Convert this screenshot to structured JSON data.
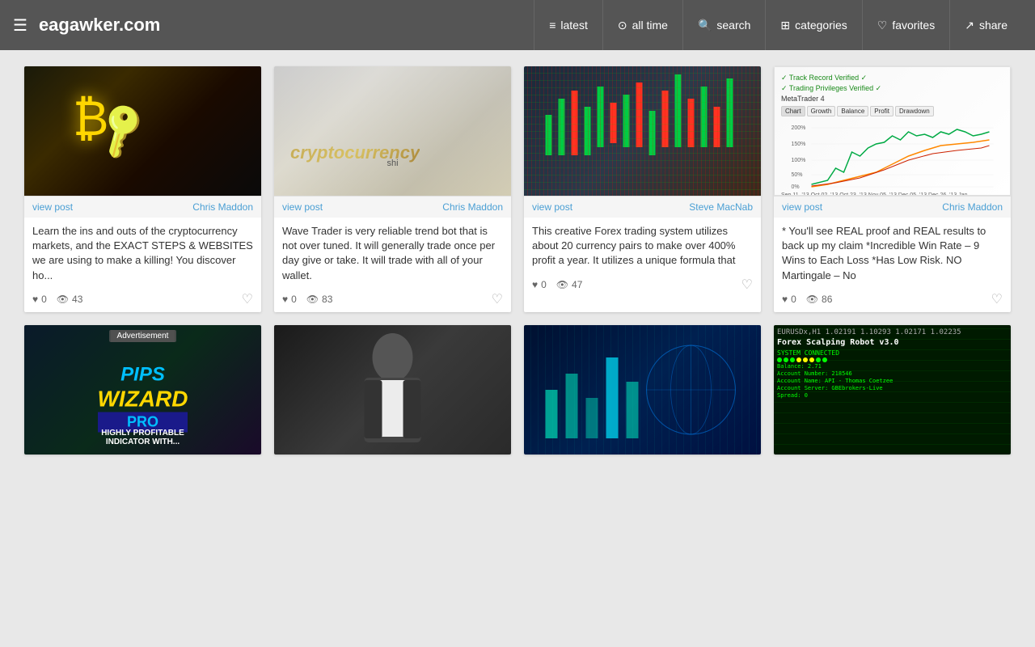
{
  "site": {
    "title": "eagawker.com"
  },
  "header": {
    "menu_icon": "☰",
    "nav": [
      {
        "id": "latest",
        "label": "latest",
        "icon": "≡"
      },
      {
        "id": "all-time",
        "label": "all time",
        "icon": "⊙"
      },
      {
        "id": "search",
        "label": "search",
        "icon": "🔍"
      },
      {
        "id": "categories",
        "label": "categories",
        "icon": "⊞"
      },
      {
        "id": "favorites",
        "label": "favorites",
        "icon": "♡"
      },
      {
        "id": "share",
        "label": "share",
        "icon": "↗"
      }
    ]
  },
  "cards": [
    {
      "id": "card-1",
      "image_type": "bitcoin",
      "view_post": "view post",
      "author": "Chris Maddon",
      "description": "Learn the ins and outs of the cryptocurrency markets, and the EXACT STEPS & WEBSITES we are using to make a killing! You discover ho...",
      "likes": "0",
      "views": "43"
    },
    {
      "id": "card-2",
      "image_type": "crypto-key",
      "view_post": "view post",
      "author": "Chris Maddon",
      "description": "Wave Trader is very reliable trend bot that is not over tuned. It will generally trade once per day give or take. It will trade with all of your wallet.",
      "likes": "0",
      "views": "83"
    },
    {
      "id": "card-3",
      "image_type": "forex-trader",
      "view_post": "view post",
      "author": "Steve MacNab",
      "description": "This creative Forex trading system utilizes about 20 currency pairs to make over 400% profit a year. It utilizes a unique formula that",
      "likes": "0",
      "views": "47"
    },
    {
      "id": "card-4",
      "image_type": "chart",
      "view_post": "view post",
      "author": "Chris Maddon",
      "description": "* You'll see REAL proof and REAL results to back up my claim *Incredible Win Rate – 9 Wins to Each Loss *Has Low Risk. NO Martingale – No",
      "likes": "0",
      "views": "86",
      "chart": {
        "verified1": "Track Record Verified ✓",
        "verified2": "Trading Privileges Verified ✓",
        "platform": "MetaTrader 4",
        "tabs": [
          "Chart",
          "Growth",
          "Balance",
          "Profit",
          "Drawdown"
        ]
      }
    }
  ],
  "bottom_cards": [
    {
      "id": "bottom-1",
      "image_type": "pips",
      "is_ad": true,
      "ad_label": "Advertisement",
      "pips_line1": "PIPS",
      "pips_line2": "WIZARD",
      "pips_line3": "PRO",
      "subtitle": "HIGHLY PROFITABLE\nINDICATOR WITH..."
    },
    {
      "id": "bottom-2",
      "image_type": "man"
    },
    {
      "id": "bottom-3",
      "image_type": "tech"
    },
    {
      "id": "bottom-4",
      "image_type": "robot",
      "robot_title": "Forex Scalping Robot v3.0",
      "robot_lines": [
        "SYSTEM CONNECTED",
        "Balance: 2.71",
        "Account Number: 218546",
        "Account Name: API - Thomas Coetzee",
        "Account Server: GBEbrokers-Live",
        "Spread: 0"
      ]
    }
  ],
  "ui": {
    "view_post_label": "view post",
    "likes_icon": "♥",
    "views_icon": "👁",
    "heart_icon": "♡"
  }
}
